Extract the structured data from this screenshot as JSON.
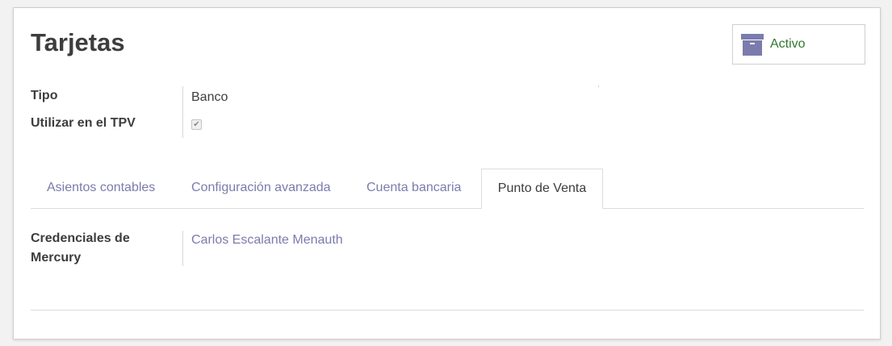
{
  "form": {
    "title": "Tarjetas",
    "archive_button": {
      "label": "Activo",
      "icon": "archive-icon"
    },
    "fields": {
      "tipo": {
        "label": "Tipo",
        "value": "Banco"
      },
      "tpv": {
        "label": "Utilizar en el TPV",
        "checked": true,
        "check_glyph": "✔"
      }
    },
    "tabs": [
      {
        "label": "Asientos contables",
        "active": false
      },
      {
        "label": "Configuración avanzada",
        "active": false
      },
      {
        "label": "Cuenta bancaria",
        "active": false
      },
      {
        "label": "Punto de Venta",
        "active": true
      }
    ],
    "tab_content": {
      "credentials": {
        "label_line1": "Credenciales de",
        "label_line2": "Mercury",
        "value": "Carlos Escalante Menauth"
      }
    }
  },
  "colors": {
    "accent": "#7c7bad",
    "active_status": "#2f7a2f"
  }
}
